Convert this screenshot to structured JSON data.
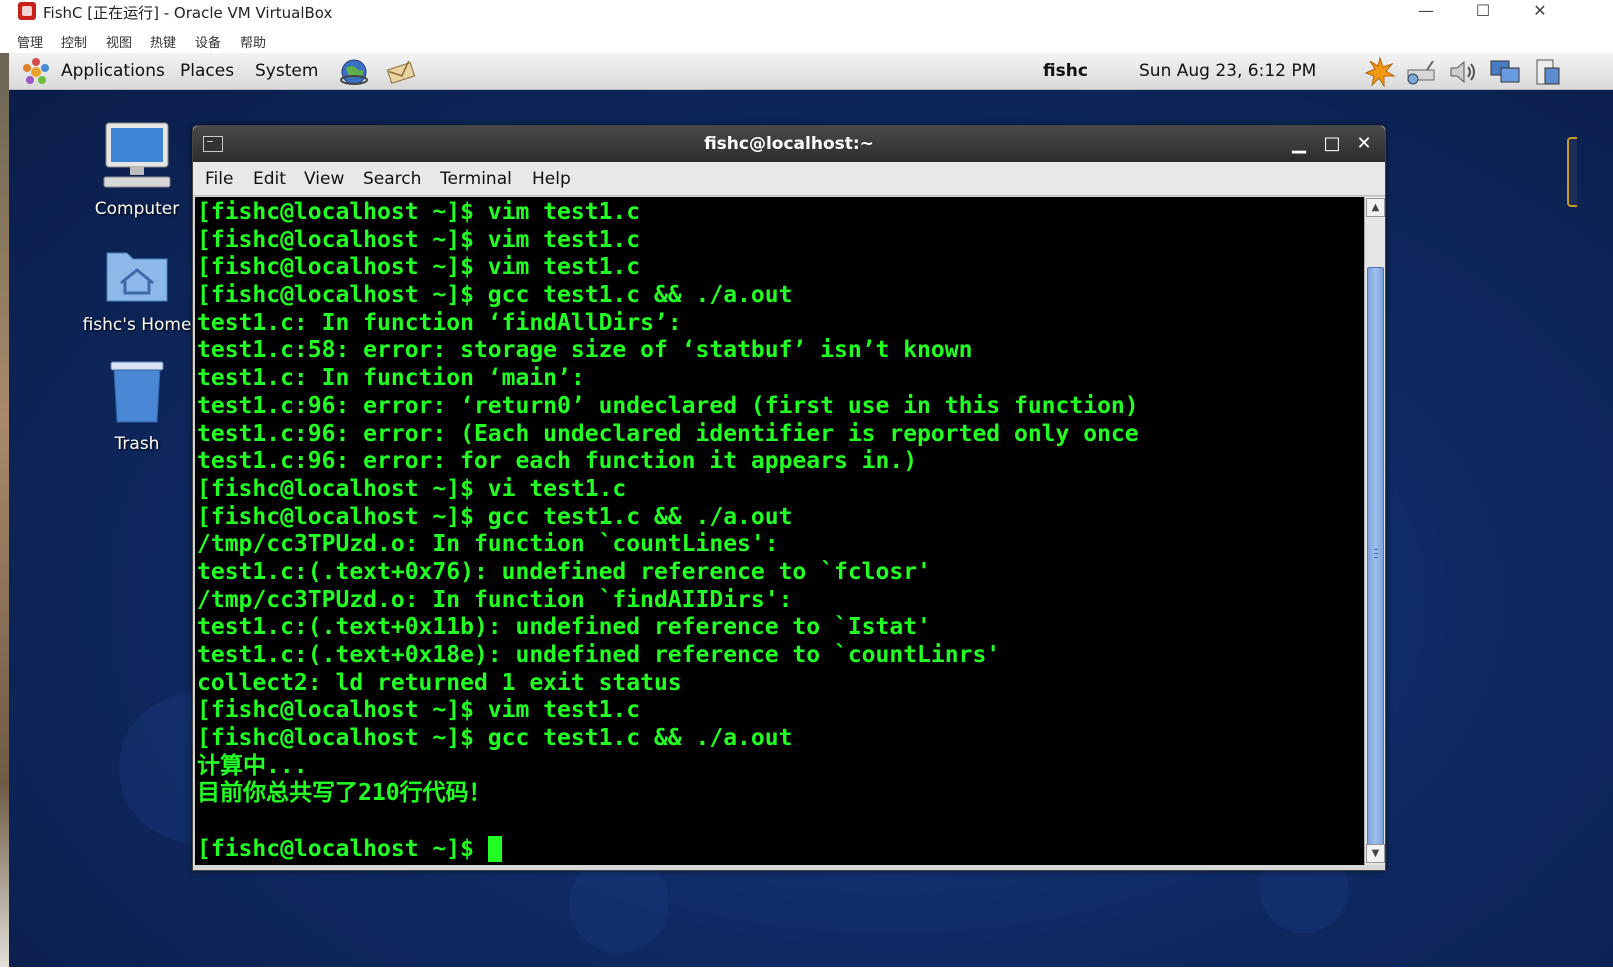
{
  "host": {
    "title": "FishC [正在运行] - Oracle VM VirtualBox",
    "menu": [
      "管理",
      "控制",
      "视图",
      "热键",
      "设备",
      "帮助"
    ],
    "controls": {
      "minimize": "—",
      "maximize": "☐",
      "close": "✕"
    }
  },
  "panel": {
    "menus": [
      "Applications",
      "Places",
      "System"
    ],
    "user": "fishc",
    "clock": "Sun Aug 23,  6:12 PM",
    "launchers": [
      "web-browser-icon",
      "email-client-icon"
    ],
    "tray_icons": [
      "update-notifier-icon",
      "network-icon",
      "volume-icon",
      "display-icon",
      "clipboard-icon"
    ]
  },
  "desktop": {
    "icons": [
      {
        "label": "Computer",
        "icon": "computer-icon"
      },
      {
        "label": "fishc's Home",
        "icon": "home-folder-icon"
      },
      {
        "label": "Trash",
        "icon": "trash-icon"
      }
    ]
  },
  "terminal": {
    "title": "fishc@localhost:~",
    "menu": [
      "File",
      "Edit",
      "View",
      "Search",
      "Terminal",
      "Help"
    ],
    "controls": {
      "minimize": "▁",
      "maximize": "□",
      "close": "✕"
    },
    "text_color": "#22ff22",
    "lines": [
      "[fishc@localhost ~]$ vim test1.c",
      "[fishc@localhost ~]$ vim test1.c",
      "[fishc@localhost ~]$ vim test1.c",
      "[fishc@localhost ~]$ gcc test1.c && ./a.out",
      "test1.c: In function ‘findAllDirs’:",
      "test1.c:58: error: storage size of ‘statbuf’ isn’t known",
      "test1.c: In function ‘main’:",
      "test1.c:96: error: ‘return0’ undeclared (first use in this function)",
      "test1.c:96: error: (Each undeclared identifier is reported only once",
      "test1.c:96: error: for each function it appears in.)",
      "[fishc@localhost ~]$ vi test1.c",
      "[fishc@localhost ~]$ gcc test1.c && ./a.out",
      "/tmp/cc3TPUzd.o: In function `countLines':",
      "test1.c:(.text+0x76): undefined reference to `fclosr'",
      "/tmp/cc3TPUzd.o: In function `findAIIDirs':",
      "test1.c:(.text+0x11b): undefined reference to `Istat'",
      "test1.c:(.text+0x18e): undefined reference to `countLinrs'",
      "collect2: ld returned 1 exit status",
      "[fishc@localhost ~]$ vim test1.c",
      "[fishc@localhost ~]$ gcc test1.c && ./a.out",
      "计算中...",
      "目前你总共写了210行代码！",
      ""
    ],
    "prompt": "[fishc@localhost ~]$ "
  }
}
